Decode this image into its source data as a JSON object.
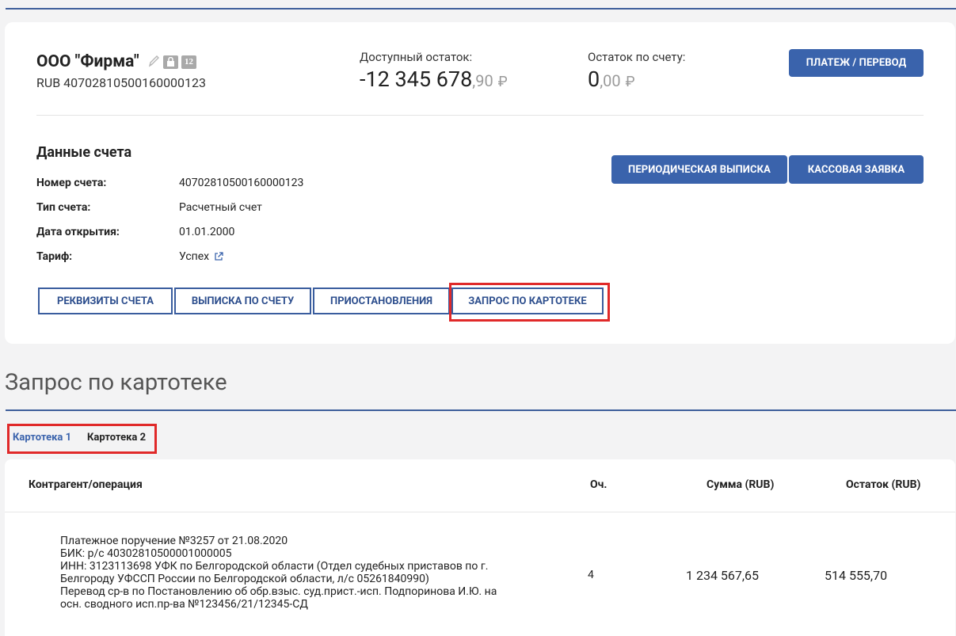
{
  "account": {
    "name": "ООО \"Фирма\"",
    "number_line": "RUB 40702810500160000123",
    "badge_text": "12"
  },
  "balances": {
    "available_label": "Доступный остаток:",
    "available_int": "-12 345 678",
    "available_dec": ",90",
    "account_label": "Остаток по счету:",
    "account_int": "0",
    "account_dec": ",00",
    "currency": "₽"
  },
  "buttons": {
    "payment": "ПЛАТЕЖ / ПЕРЕВОД",
    "periodic": "ПЕРИОДИЧЕСКАЯ ВЫПИСКА",
    "cash": "КАССОВАЯ ЗАЯВКА"
  },
  "details": {
    "title": "Данные счета",
    "rows": [
      {
        "label": "Номер счета:",
        "value": "40702810500160000123"
      },
      {
        "label": "Тип счета:",
        "value": "Расчетный счет"
      },
      {
        "label": "Дата открытия:",
        "value": "01.01.2000"
      },
      {
        "label": "Тариф:",
        "value": "Успех"
      }
    ]
  },
  "actions": [
    "РЕКВИЗИТЫ СЧЕТА",
    "ВЫПИСКА ПО СЧЕТУ",
    "ПРИОСТАНОВЛЕНИЯ",
    "ЗАПРОС ПО КАРТОТЕКЕ"
  ],
  "page_title": "Запрос по картотеке",
  "tabs": [
    {
      "label": "Картотека 1",
      "active": true
    },
    {
      "label": "Картотека 2",
      "active": false
    }
  ],
  "table": {
    "headers": [
      "Контрагент/операция",
      "Оч.",
      "Сумма (RUB)",
      "Остаток (RUB)"
    ],
    "row": {
      "lines": [
        "Платежное поручение №3257 от 21.08.2020",
        "БИК: р/с 40302810500001000005",
        "ИНН: 3123113698 УФК по Белгородской области (Отдел судебных приставов по г.",
        "Белгороду УФССП России по Белгородской области, л/с 05261840990)",
        "Перевод ср-в по Постановлению об обр.взыс. суд.прист.-исп. Подпоринова И.Ю. на",
        "осн. сводного исп.пр-ва №123456/21/12345-СД"
      ],
      "queue": "4",
      "sum": "1 234 567,65",
      "remaining": "514 555,70"
    }
  },
  "colors": {
    "primary": "#3a63ac",
    "highlight": "#e02929",
    "tab_active": "#3a63ac"
  }
}
